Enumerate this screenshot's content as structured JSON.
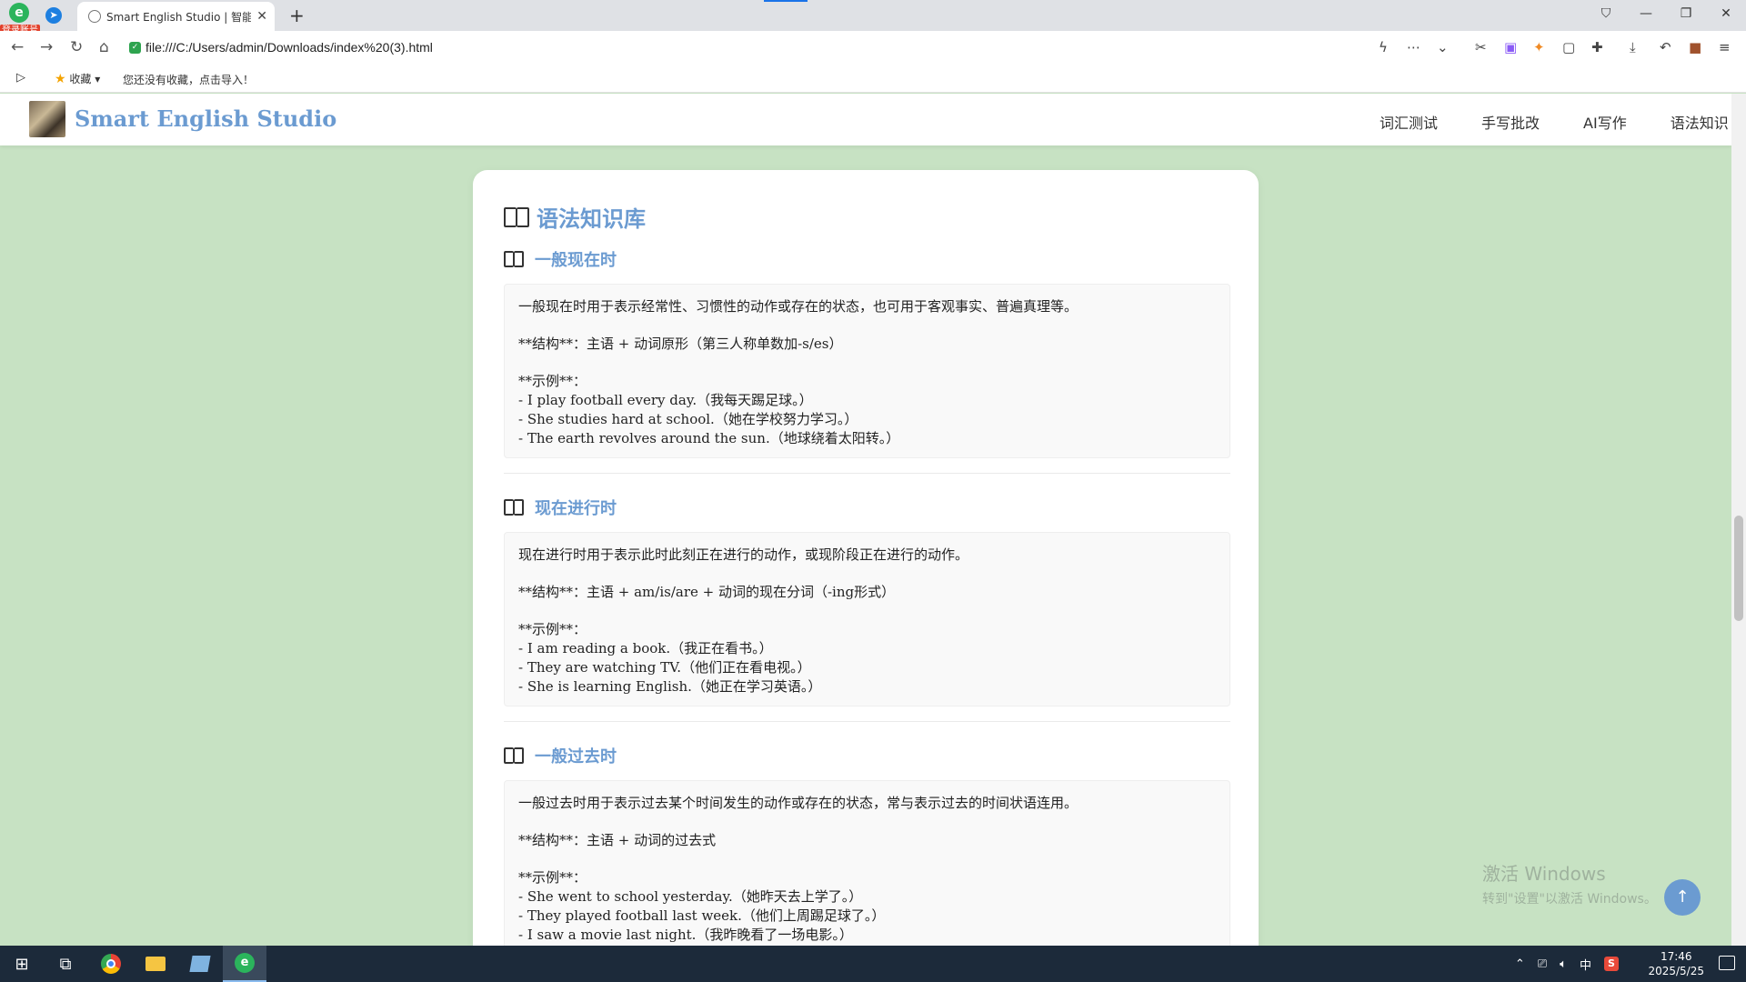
{
  "browser": {
    "login_badge": "登录账号",
    "tab_title": "Smart English Studio | 智能英",
    "url": "file:///C:/Users/admin/Downloads/index%20(3).html",
    "bookmarks_label": "收藏",
    "bookmarks_hint": "您还没有收藏，点击导入！"
  },
  "site": {
    "brand": "Smart English Studio",
    "nav": [
      "词汇测试",
      "手写批改",
      "AI写作",
      "语法知识"
    ]
  },
  "page": {
    "heading": "语法知识库",
    "sections": [
      {
        "title": "一般现在时",
        "description": "一般现在时用于表示经常性、习惯性的动作或存在的状态，也可用于客观事实、普遍真理等。",
        "structure": "**结构**：主语 + 动词原形（第三人称单数加-s/es）",
        "examples_label": "**示例**：",
        "examples": [
          "- I play football every day.（我每天踢足球。）",
          "- She studies hard at school.（她在学校努力学习。）",
          "- The earth revolves around the sun.（地球绕着太阳转。）"
        ]
      },
      {
        "title": "现在进行时",
        "description": "现在进行时用于表示此时此刻正在进行的动作，或现阶段正在进行的动作。",
        "structure": "**结构**：主语 + am/is/are + 动词的现在分词（-ing形式）",
        "examples_label": "**示例**：",
        "examples": [
          "- I am reading a book.（我正在看书。）",
          "- They are watching TV.（他们正在看电视。）",
          "- She is learning English.（她正在学习英语。）"
        ]
      },
      {
        "title": "一般过去时",
        "description": "一般过去时用于表示过去某个时间发生的动作或存在的状态，常与表示过去的时间状语连用。",
        "structure": "**结构**：主语 + 动词的过去式",
        "examples_label": "**示例**：",
        "examples": [
          "- She went to school yesterday.（她昨天去上学了。）",
          "- They played football last week.（他们上周踢足球了。）",
          "- I saw a movie last night.（我昨晚看了一场电影。）"
        ]
      }
    ]
  },
  "watermark": {
    "line1": "激活 Windows",
    "line2": "转到\"设置\"以激活 Windows。"
  },
  "taskbar": {
    "ime": "中",
    "time": "17:46",
    "date": "2025/5/25"
  }
}
